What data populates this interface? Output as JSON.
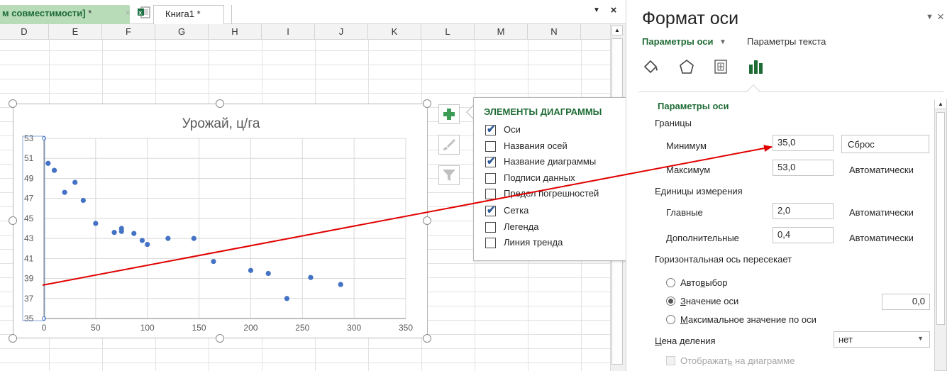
{
  "tabs": {
    "compat_label": "м совместимости]",
    "compat_star": " *",
    "close_glyph": "×",
    "book_label": "Книга1 *",
    "dropdown_glyph": "▼",
    "window_close_glyph": "×"
  },
  "columns": [
    "D",
    "E",
    "F",
    "G",
    "H",
    "I",
    "J",
    "K",
    "L",
    "M",
    "N"
  ],
  "chart": {
    "title": "Урожай, ц/га",
    "chart_data": {
      "type": "scatter",
      "title": "Урожай, ц/га",
      "xlabel": "",
      "ylabel": "",
      "xlim": [
        0,
        350
      ],
      "ylim": [
        35,
        53
      ],
      "x_ticks": [
        0,
        50,
        100,
        150,
        200,
        250,
        300,
        350
      ],
      "y_ticks": [
        35,
        37,
        39,
        41,
        43,
        45,
        47,
        49,
        51,
        53
      ],
      "grid": true,
      "legend": "none",
      "series": [
        {
          "color": "#4472c4",
          "points": [
            [
              4,
              50.5
            ],
            [
              10,
              49.8
            ],
            [
              20,
              47.6
            ],
            [
              30,
              48.6
            ],
            [
              38,
              46.8
            ],
            [
              50,
              44.5
            ],
            [
              68,
              43.6
            ],
            [
              75,
              44.0
            ],
            [
              75,
              43.7
            ],
            [
              87,
              43.5
            ],
            [
              95,
              42.8
            ],
            [
              100,
              42.4
            ],
            [
              120,
              43.0
            ],
            [
              145,
              43.0
            ],
            [
              164,
              40.7
            ],
            [
              200,
              39.8
            ],
            [
              217,
              39.5
            ],
            [
              235,
              37.0
            ],
            [
              258,
              39.1
            ],
            [
              287,
              38.4
            ]
          ]
        }
      ]
    }
  },
  "elements_popup": {
    "title": "ЭЛЕМЕНТЫ ДИАГРАММЫ",
    "items": [
      {
        "label": "Оси",
        "checked": true
      },
      {
        "label": "Названия осей",
        "checked": false
      },
      {
        "label": "Название диаграммы",
        "checked": true
      },
      {
        "label": "Подписи данных",
        "checked": false
      },
      {
        "label": "Предел погрешностей",
        "checked": false
      },
      {
        "label": "Сетка",
        "checked": true
      },
      {
        "label": "Легенда",
        "checked": false
      },
      {
        "label": "Линия тренда",
        "checked": false
      }
    ],
    "check_glyph": "✔"
  },
  "pane": {
    "title": "Формат оси",
    "dropdown_glyph": "▼",
    "close_glyph": "×",
    "tab_axis": "Параметры оси",
    "tab_axis_arrow": "▼",
    "tab_text": "Параметры текста",
    "icons": [
      "fill-line-icon",
      "effects-icon",
      "size-properties-icon",
      "axis-options-icon"
    ],
    "section_title": "Параметры оси",
    "bounds_label": "Границы",
    "min_label": "Минимум",
    "min_value": "35,0",
    "reset_label": "Сброс",
    "max_label": "Максимум",
    "max_value": "53,0",
    "auto_label": "Автоматически",
    "units_label": "Единицы измерения",
    "major_label": "Главные",
    "major_value": "2,0",
    "minor_label": "Дополнительные",
    "minor_value": "0,4",
    "crosses_label": "Горизонтальная ось пересекает",
    "radio_auto_a": "Авто",
    "radio_auto_u": "в",
    "radio_auto_b": "ыбор",
    "radio_value_u": "З",
    "radio_value_b": "начение оси",
    "axis_value": "0,0",
    "radio_max_u": "М",
    "radio_max_b": "аксимальное значение по оси",
    "unit_label_a": "Ц",
    "unit_label_b": "ена деления",
    "unit_select": "нет",
    "show_on_chart_a": "Отображат",
    "show_on_chart_u": "ь",
    "show_on_chart_b": " на диаграмме"
  },
  "colors": {
    "accent_green": "#1f6b35",
    "marker_blue": "#4472c4",
    "annotation_red": "#e00000"
  }
}
